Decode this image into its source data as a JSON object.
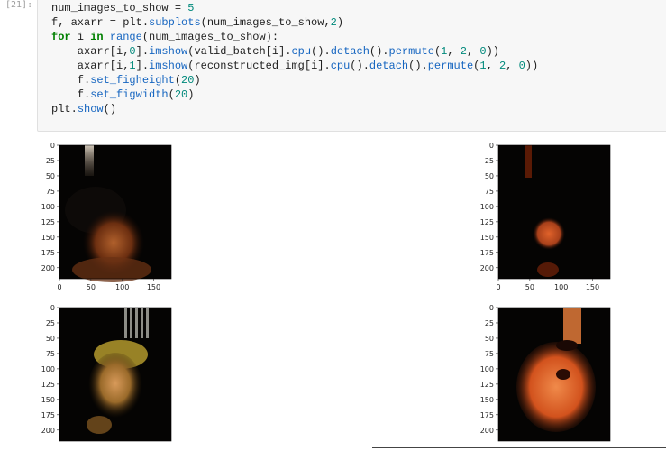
{
  "cell": {
    "prompt": "[21]:",
    "code_lines": [
      [
        {
          "t": "num_images_to_show = ",
          "c": ""
        },
        {
          "t": "5",
          "c": "num"
        }
      ],
      [
        {
          "t": "f, axarr = plt.",
          "c": ""
        },
        {
          "t": "subplots",
          "c": "fn"
        },
        {
          "t": "(num_images_to_show,",
          "c": ""
        },
        {
          "t": "2",
          "c": "num"
        },
        {
          "t": ")",
          "c": ""
        }
      ],
      [
        {
          "t": "for",
          "c": "kw"
        },
        {
          "t": " i ",
          "c": ""
        },
        {
          "t": "in",
          "c": "kw"
        },
        {
          "t": " ",
          "c": ""
        },
        {
          "t": "range",
          "c": "fn"
        },
        {
          "t": "(num_images_to_show):",
          "c": ""
        }
      ],
      [
        {
          "t": "    axarr[i,",
          "c": ""
        },
        {
          "t": "0",
          "c": "num"
        },
        {
          "t": "].",
          "c": ""
        },
        {
          "t": "imshow",
          "c": "fn"
        },
        {
          "t": "(valid_batch[i].",
          "c": ""
        },
        {
          "t": "cpu",
          "c": "fn"
        },
        {
          "t": "().",
          "c": ""
        },
        {
          "t": "detach",
          "c": "fn"
        },
        {
          "t": "().",
          "c": ""
        },
        {
          "t": "permute",
          "c": "fn"
        },
        {
          "t": "(",
          "c": ""
        },
        {
          "t": "1",
          "c": "num"
        },
        {
          "t": ", ",
          "c": ""
        },
        {
          "t": "2",
          "c": "num"
        },
        {
          "t": ", ",
          "c": ""
        },
        {
          "t": "0",
          "c": "num"
        },
        {
          "t": "))",
          "c": ""
        }
      ],
      [
        {
          "t": "    axarr[i,",
          "c": ""
        },
        {
          "t": "1",
          "c": "num"
        },
        {
          "t": "].",
          "c": ""
        },
        {
          "t": "imshow",
          "c": "fn"
        },
        {
          "t": "(reconstructed_img[i].",
          "c": ""
        },
        {
          "t": "cpu",
          "c": "fn"
        },
        {
          "t": "().",
          "c": ""
        },
        {
          "t": "detach",
          "c": "fn"
        },
        {
          "t": "().",
          "c": ""
        },
        {
          "t": "permute",
          "c": "fn"
        },
        {
          "t": "(",
          "c": ""
        },
        {
          "t": "1",
          "c": "num"
        },
        {
          "t": ", ",
          "c": ""
        },
        {
          "t": "2",
          "c": "num"
        },
        {
          "t": ", ",
          "c": ""
        },
        {
          "t": "0",
          "c": "num"
        },
        {
          "t": "))",
          "c": ""
        }
      ],
      [
        {
          "t": "    f.",
          "c": ""
        },
        {
          "t": "set_figheight",
          "c": "fn"
        },
        {
          "t": "(",
          "c": ""
        },
        {
          "t": "20",
          "c": "num"
        },
        {
          "t": ")",
          "c": ""
        }
      ],
      [
        {
          "t": "    f.",
          "c": ""
        },
        {
          "t": "set_figwidth",
          "c": "fn"
        },
        {
          "t": "(",
          "c": ""
        },
        {
          "t": "20",
          "c": "num"
        },
        {
          "t": ")",
          "c": ""
        }
      ],
      [
        {
          "t": "plt.",
          "c": ""
        },
        {
          "t": "show",
          "c": "fn"
        },
        {
          "t": "()",
          "c": ""
        }
      ]
    ]
  },
  "output": {
    "y_ticks": [
      "0",
      "25",
      "50",
      "75",
      "100",
      "125",
      "150",
      "175",
      "200"
    ],
    "x_ticks": [
      "0",
      "50",
      "100",
      "150"
    ],
    "panels": [
      {
        "name": "row1-original-face",
        "kind": "original-dark"
      },
      {
        "name": "row1-reconstructed-face",
        "kind": "recon-dark"
      },
      {
        "name": "row2-original-face",
        "kind": "original-bright"
      },
      {
        "name": "row2-reconstructed-face",
        "kind": "recon-bright"
      }
    ],
    "colors": {
      "image_bg": "#050403",
      "recon_orange": "#d2521d",
      "skin_green": "#a8902a",
      "tick_color": "#262626"
    }
  }
}
